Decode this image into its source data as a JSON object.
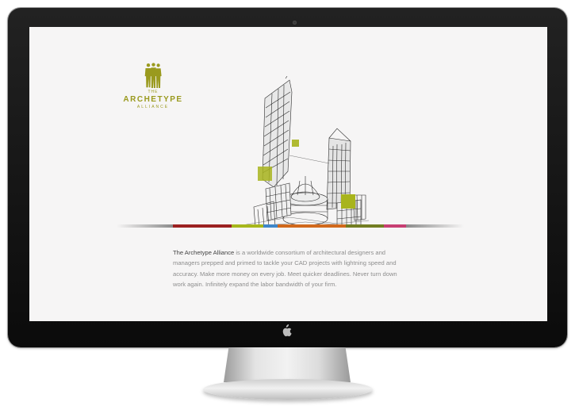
{
  "logo": {
    "line1": "THE",
    "line2": "ARCHETYPE",
    "line3": "ALLIANCE",
    "color": "#9a9a1e"
  },
  "hero": {
    "icon": "architecture-wireframe-illustration",
    "accent_color": "#a8b41d"
  },
  "colorbar": {
    "segments": [
      "#8b8b8b",
      "#9c2121",
      "#a7b71c",
      "#3f87c9",
      "#d1691c",
      "#737d22",
      "#c73f73",
      "#8b8b8b"
    ]
  },
  "intro": {
    "lead": "The Archetype Alliance",
    "body": " is a worldwide consortium of architectural designers and managers prepped and primed to tackle your CAD projects with lightning speed and accuracy. Make more money on every job. Meet quicker deadlines. Never turn down work again. Infinitely expand the labor bandwidth of your firm."
  }
}
